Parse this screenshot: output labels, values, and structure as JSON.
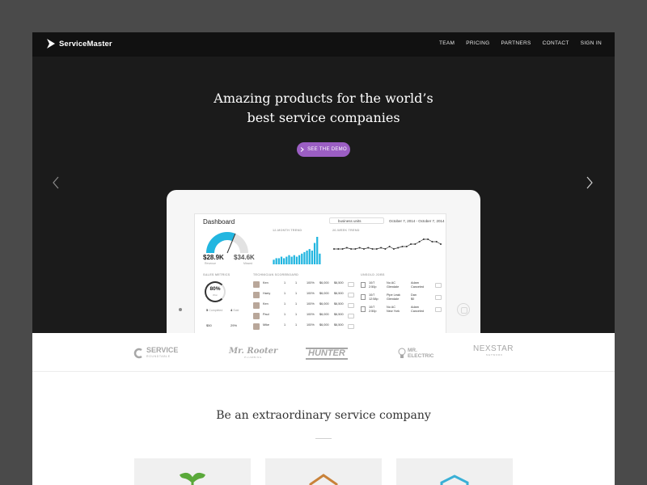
{
  "brand": {
    "name": "ServiceMaster"
  },
  "nav": {
    "items": [
      "TEAM",
      "PRICING",
      "PARTNERS",
      "CONTACT",
      "SIGN IN"
    ]
  },
  "hero": {
    "headline_line1": "Amazing products for the world’s",
    "headline_line2": "best service companies",
    "cta_label": "SEE THE DEMO",
    "accent_color": "#9b5ec3"
  },
  "dashboard": {
    "title": "Dashboard",
    "unit_select": "business units",
    "date_range": "October 7, 2014 - October 7, 2014",
    "trend12_label": "12-MONTH TREND",
    "trend26_label": "26-WEEK TREND",
    "gauge": {
      "revenue": "$28.9K",
      "revenue_label": "Revenue",
      "missed": "$34.6K",
      "missed_label": "Missed",
      "accent_color": "#22b6e0"
    },
    "trend12_values": [
      3,
      4,
      4,
      5,
      4,
      5,
      6,
      5,
      6,
      5,
      6,
      7,
      8,
      9,
      10,
      9,
      14,
      18,
      7
    ],
    "trend26_values": [
      5,
      5,
      5,
      5.5,
      5,
      5,
      5.5,
      5,
      5.5,
      5,
      5,
      5.5,
      5,
      6,
      5,
      5.5,
      6,
      6,
      7,
      7,
      8,
      9,
      9,
      8,
      8,
      7
    ],
    "sales_metrics_label": "SALES METRICS",
    "donut_value": "80%",
    "donut_sub": "Won",
    "stats": [
      {
        "value": "5",
        "label": "Completed"
      },
      {
        "value": "4",
        "label": "Sold"
      },
      {
        "value": "$50",
        "label": ""
      },
      {
        "value": "29%",
        "label": ""
      }
    ],
    "scoreboard_label": "TECHNICIAN SCOREBOARD",
    "technicians": [
      {
        "name": "Ken",
        "jobs": "1",
        "sales": "1",
        "pct": "100%",
        "avg": "$6,000",
        "revenue": "$6,500"
      },
      {
        "name": "Harry",
        "jobs": "1",
        "sales": "1",
        "pct": "100%",
        "avg": "$6,000",
        "revenue": "$6,500"
      },
      {
        "name": "Ken",
        "jobs": "1",
        "sales": "1",
        "pct": "100%",
        "avg": "$6,000",
        "revenue": "$6,500"
      },
      {
        "name": "Paul",
        "jobs": "1",
        "sales": "1",
        "pct": "100%",
        "avg": "$6,000",
        "revenue": "$6,500"
      },
      {
        "name": "Mike",
        "jobs": "1",
        "sales": "1",
        "pct": "100%",
        "avg": "$6,000",
        "revenue": "$6,500"
      }
    ],
    "jobs_label": "UNSOLD JOBS",
    "jobs": [
      {
        "date": "10/7",
        "time": "2:50p",
        "issue": "No AC",
        "city": "Glendale",
        "person": "Adam",
        "status": "Canceled"
      },
      {
        "date": "10/7",
        "time": "12:58p",
        "issue": "Pipe Leak",
        "city": "Glendale",
        "person": "Dan",
        "status": "$0"
      },
      {
        "date": "10/7",
        "time": "2:50p",
        "issue": "No AC",
        "city": "New York",
        "person": "Adam",
        "status": "Canceled"
      }
    ]
  },
  "partners": [
    "SERVICE",
    "Mr. Rooter",
    "HUNTER",
    "MR. ELECTRIC",
    "NEXSTAR"
  ],
  "partner_subs": [
    "ROUNDTABLE",
    "PLUMBING",
    "",
    "",
    "NETWORK"
  ],
  "section": {
    "title": "Be an extraordinary service company"
  },
  "feature_icon_colors": [
    "#5aa93a",
    "#c9823a",
    "#3ab0d6"
  ]
}
